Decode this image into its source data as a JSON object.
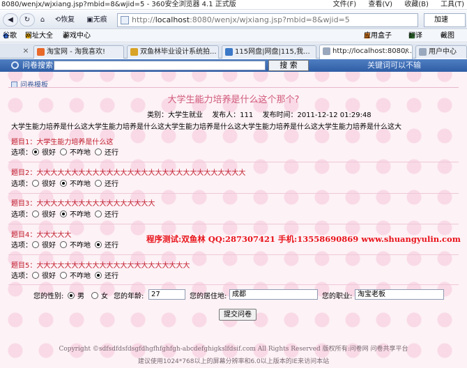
{
  "window": {
    "title": "8080/wenjx/wjxiang.jsp?mbid=8&wjid=5 - 360安全浏览器 4.1 正式版",
    "menus": [
      "文件(F)",
      "查看(V)",
      "收藏(B)",
      "工具(T)"
    ]
  },
  "nav": {
    "back_label": "恢复",
    "adblock_label": "无痕",
    "address_prefix": "http://",
    "address_host": "localhost",
    "address_rest": ":8080/wenjx/wjxiang.jsp?mbid=8&wjid=5",
    "speed_label": "加速"
  },
  "favorites": {
    "items": [
      "谷歌",
      "网址大全",
      "游戏中心"
    ],
    "right_items": [
      "应用盒子",
      "翻译",
      "截图"
    ]
  },
  "tabs": [
    {
      "label": "淘宝网 - 淘我喜欢!",
      "color": "#e8692a"
    },
    {
      "label": "双鱼林毕业设计系统拍...",
      "color": "#d8a326"
    },
    {
      "label": "115网盘|网盘|115,我...",
      "color": "#3b78c7"
    },
    {
      "label": "http://localhost:8080/...",
      "color": "#9aa8bd",
      "active": true
    },
    {
      "label": "用户中心",
      "color": "#9aa8bd"
    }
  ],
  "searchbar": {
    "label": "问卷搜索:",
    "button": "搜 索",
    "hint": "关键词可以不输",
    "input_value": ""
  },
  "module_title": "问卷模板",
  "survey": {
    "title": "大学生能力培养是什么这个那个?",
    "category_label": "类别：大学生就业",
    "publisher_label": "发布人：111",
    "time_label": "发布时间：2011-12-12 01:29:48",
    "description": "大学生能力培养是什么这大学生能力培养是什么这大学生能力培养是什么这大学生能力培养是什么这大学生能力培养是什么这大"
  },
  "questions": [
    {
      "label": "题目1：大学生能力培养是什么这",
      "options": [
        "很好",
        "不咋地",
        "还行"
      ],
      "selected": 0
    },
    {
      "label": "题目2：大大大大大大大大大大大大大大大大大大大大大大大大大大大大大大",
      "options": [
        "很好",
        "不咋地",
        "还行"
      ],
      "selected": 1
    },
    {
      "label": "题目3：大大大大大大大大大大大大大大大大大",
      "options": [
        "很好",
        "不咋地",
        "还行"
      ],
      "selected": 1
    },
    {
      "label": "题目4：大大大大大",
      "options": [
        "很好",
        "不咋地",
        "还行"
      ],
      "selected": 2
    },
    {
      "label": "题目5：大大大大大大大大大大大大大大大大大大大大大大",
      "options": [
        "很好",
        "不咋地",
        "还行"
      ],
      "selected": 2
    }
  ],
  "option_prefix": "选项：",
  "watermark": "程序测试:双鱼林 QQ:287307421 手机:13558690869 www.shuangyulin.com",
  "profile": {
    "gender_label": "您的性别:",
    "gender_options": [
      "男",
      "女"
    ],
    "gender_selected": 0,
    "age_label": "您的年龄:",
    "age_value": "27",
    "residence_label": "您的居住地:",
    "residence_value": "成都",
    "job_label": "您的职业:",
    "job_value": "淘宝老板"
  },
  "submit_label": "提交问卷",
  "footer": {
    "copyright": "Copyright ©sdfsdfdsfdsgfdhgfhfghfgh-abcdefghigkslfdsif.com All Rights Reserved 版权所有:问卷网  问卷共享平台",
    "tip": "建议使用1024*768以上的屏幕分辨率和6.0以上版本的IE来访问本站"
  }
}
